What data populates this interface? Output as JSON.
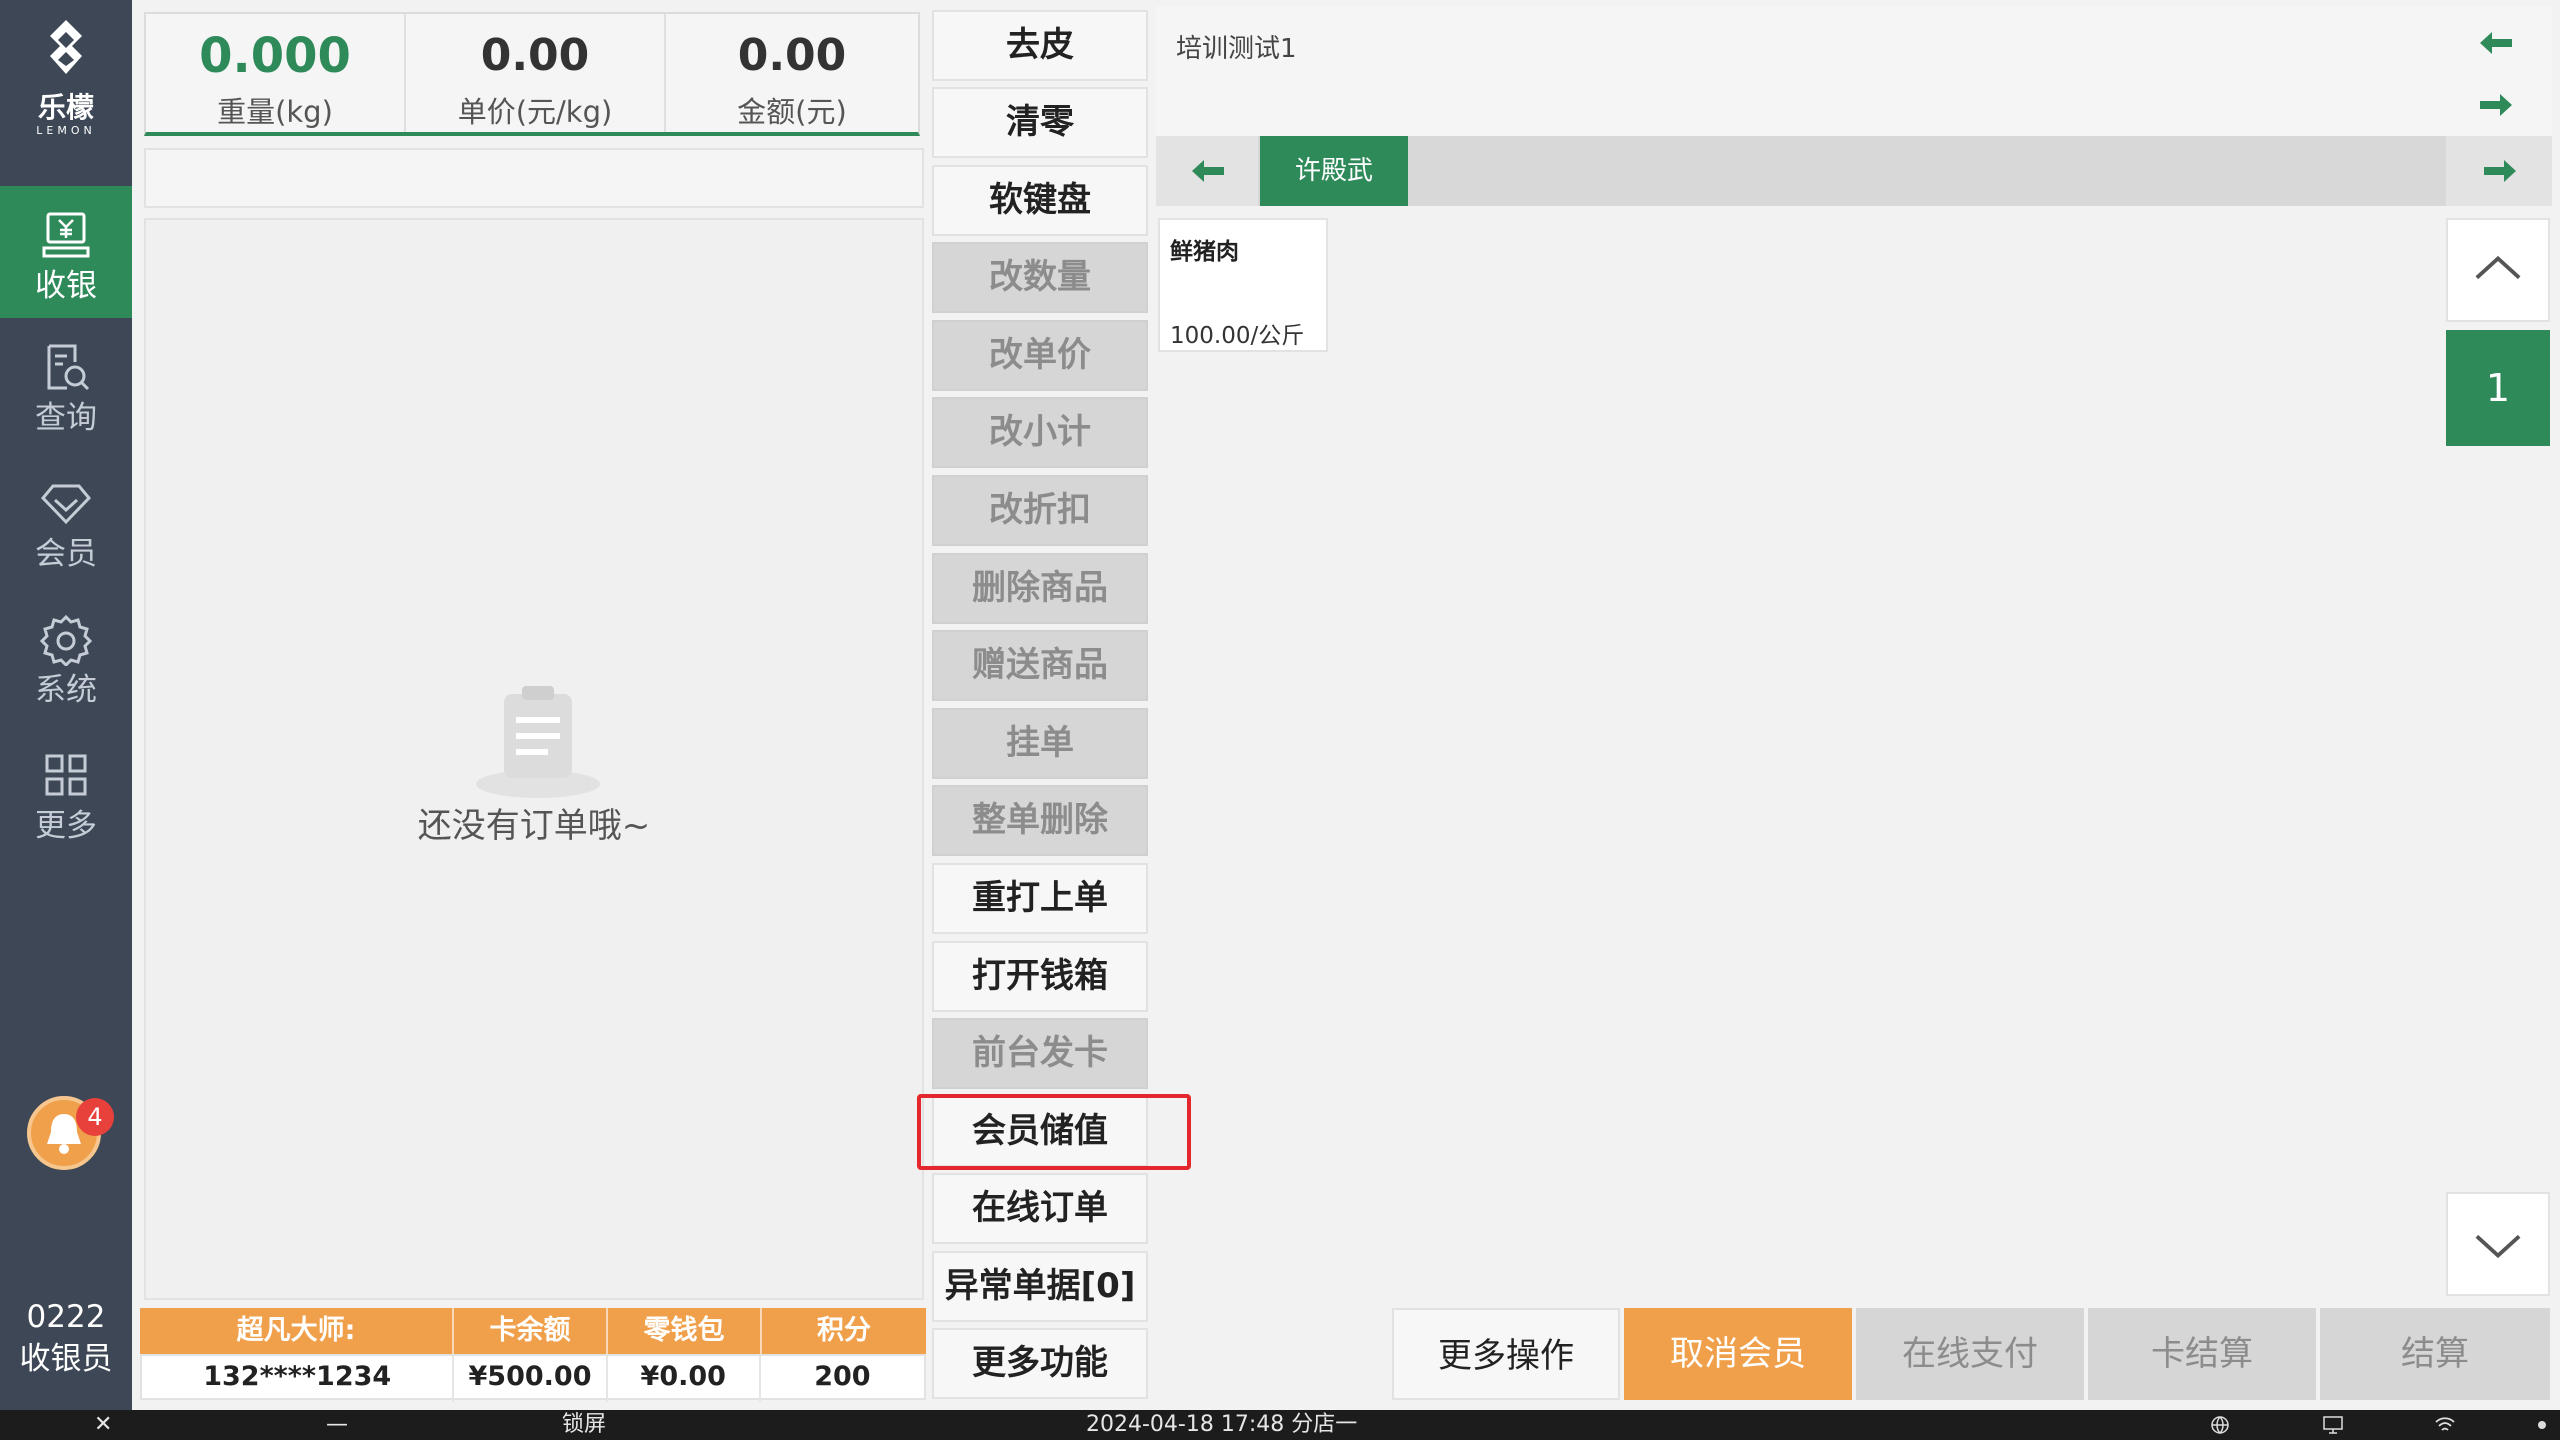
{
  "brand": {
    "name_cn": "乐檬",
    "name_en": "LEMON"
  },
  "nav": {
    "items": [
      {
        "label": "收银"
      },
      {
        "label": "查询"
      },
      {
        "label": "会员"
      },
      {
        "label": "系统"
      },
      {
        "label": "更多"
      }
    ]
  },
  "notification": {
    "count": "4"
  },
  "cashier": {
    "id": "0222",
    "role": "收银员"
  },
  "scale": {
    "weight_value": "0.000",
    "weight_label": "重量(kg)",
    "unit_price_value": "0.00",
    "unit_price_label": "单价(元/kg)",
    "amount_value": "0.00",
    "amount_label": "金额(元)"
  },
  "order": {
    "empty_text": "还没有订单哦~"
  },
  "member": {
    "headers": [
      "超凡大师:",
      "卡余额",
      "零钱包",
      "积分"
    ],
    "values": [
      "132****1234",
      "¥500.00",
      "¥0.00",
      "200"
    ]
  },
  "functions": [
    {
      "label": "去皮"
    },
    {
      "label": "清零"
    },
    {
      "label": "软键盘"
    },
    {
      "label": "改数量"
    },
    {
      "label": "改单价"
    },
    {
      "label": "改小计"
    },
    {
      "label": "改折扣"
    },
    {
      "label": "删除商品"
    },
    {
      "label": "赠送商品"
    },
    {
      "label": "挂单"
    },
    {
      "label": "整单删除"
    },
    {
      "label": "重打上单"
    },
    {
      "label": "打开钱箱"
    },
    {
      "label": "前台发卡"
    },
    {
      "label": "会员储值"
    },
    {
      "label": "在线订单"
    },
    {
      "label": "异常单据[0]"
    },
    {
      "label": "更多功能"
    }
  ],
  "category": {
    "title": "培训测试1",
    "active_tab": "许殿武"
  },
  "products": [
    {
      "name": "鲜猪肉",
      "price": "100.00/公斤"
    }
  ],
  "pagination": {
    "current": "1"
  },
  "actions": {
    "more_ops": "更多操作",
    "cancel_member": "取消会员",
    "online_pay": "在线支付",
    "card_checkout": "卡结算",
    "checkout": "结算"
  },
  "taskbar": {
    "close": "✕",
    "minimize": "—",
    "lock": "锁屏",
    "datetime_store": "2024-04-18 17:48 分店一"
  },
  "colors": {
    "primary": "#2f8a5a",
    "accent": "#f0a04b",
    "sidebar": "#3d4756",
    "highlight": "#e4262d"
  }
}
